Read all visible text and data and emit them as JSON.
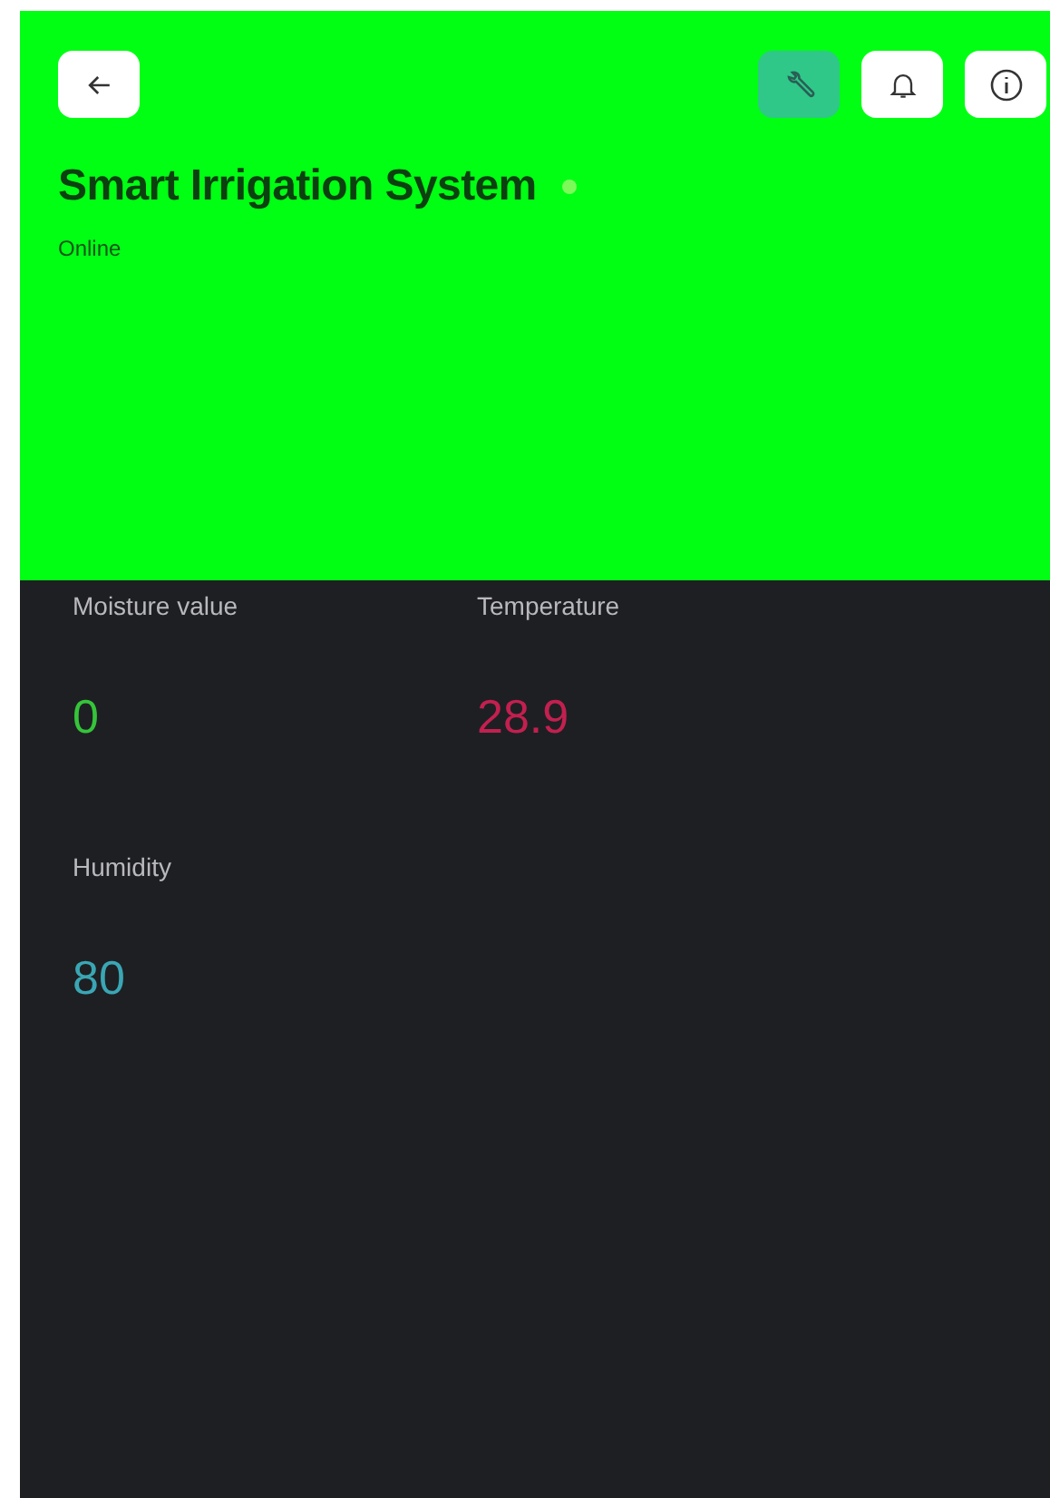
{
  "toolbar": [
    {
      "kind": "back",
      "selected": false
    },
    {
      "kind": "wrench",
      "selected": true
    },
    {
      "kind": "bell",
      "selected": false
    },
    {
      "kind": "info",
      "selected": false
    }
  ],
  "device": {
    "title": "Smart Irrigation System",
    "status": "Online",
    "online": true
  },
  "widgets": [
    {
      "label": "Moisture value",
      "value": "0",
      "color": "#35c43a"
    },
    {
      "label": "Temperature",
      "value": "28.9",
      "color": "#c2204f"
    },
    {
      "label": "Humidity",
      "value": "80",
      "color": "#3aa6b4"
    }
  ]
}
